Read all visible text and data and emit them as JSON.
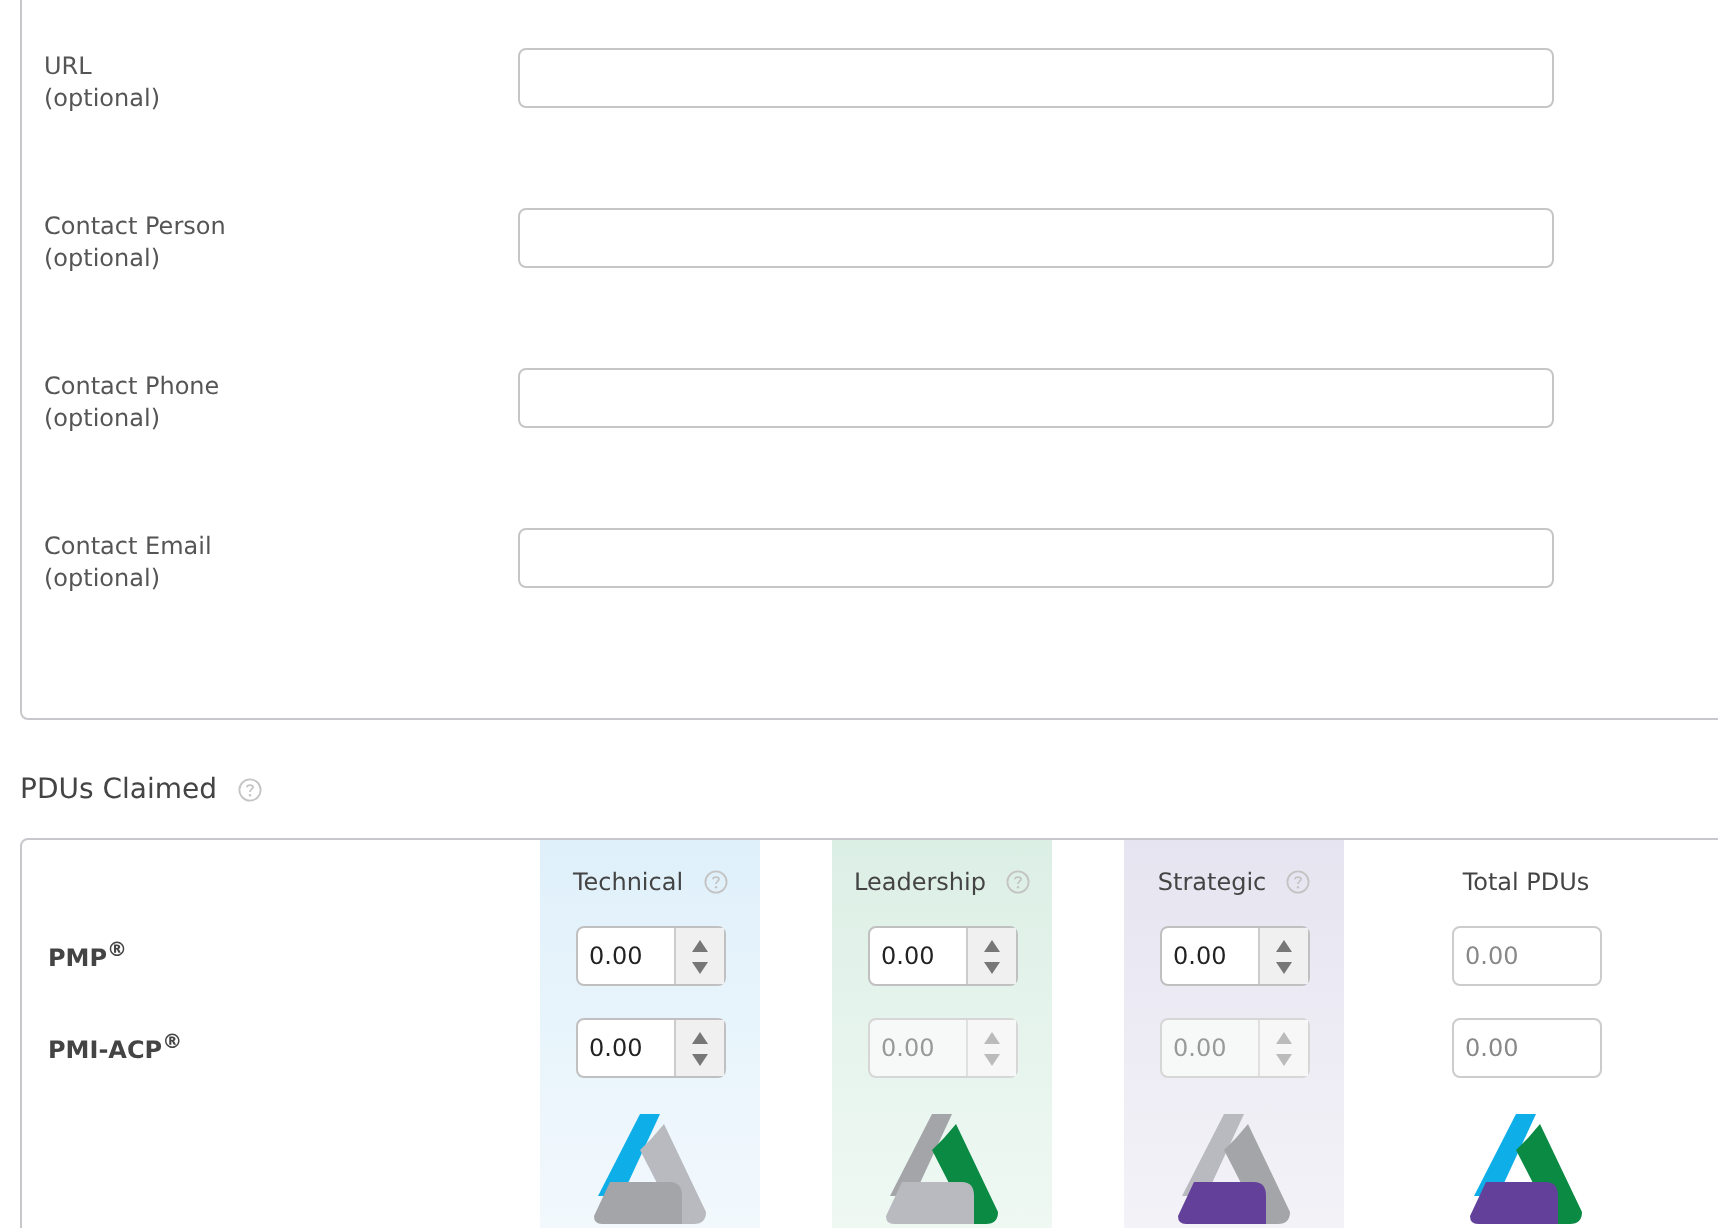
{
  "contact_fields": [
    {
      "label": "URL",
      "note": "(optional)"
    },
    {
      "label": "Contact Person",
      "note": "(optional)"
    },
    {
      "label": "Contact Phone",
      "note": "(optional)"
    },
    {
      "label": "Contact Email",
      "note": "(optional)"
    }
  ],
  "pdus": {
    "title": "PDUs Claimed",
    "help": true,
    "rows": [
      {
        "label": "PMP$^{®}$"
      },
      {
        "label": "PMI-ACP$^{®}$"
      }
    ],
    "columns": [
      {
        "kind": "technical",
        "label": "Technical",
        "help": true,
        "cells": [
          {
            "value": "0.00",
            "disabled": false
          },
          {
            "value": "0.00",
            "disabled": false
          }
        ]
      },
      {
        "kind": "leadership",
        "label": "Leadership",
        "help": true,
        "cells": [
          {
            "value": "0.00",
            "disabled": false
          },
          {
            "value": "0.00",
            "disabled": true
          }
        ]
      },
      {
        "kind": "strategic",
        "label": "Strategic",
        "help": true,
        "cells": [
          {
            "value": "0.00",
            "disabled": false
          },
          {
            "value": "0.00",
            "disabled": true
          }
        ]
      },
      {
        "kind": "total",
        "label": "Total PDUs",
        "help": false,
        "cells": [
          {
            "value": "0.00",
            "disabled": false
          },
          {
            "value": "0.00",
            "disabled": false
          }
        ]
      }
    ]
  }
}
